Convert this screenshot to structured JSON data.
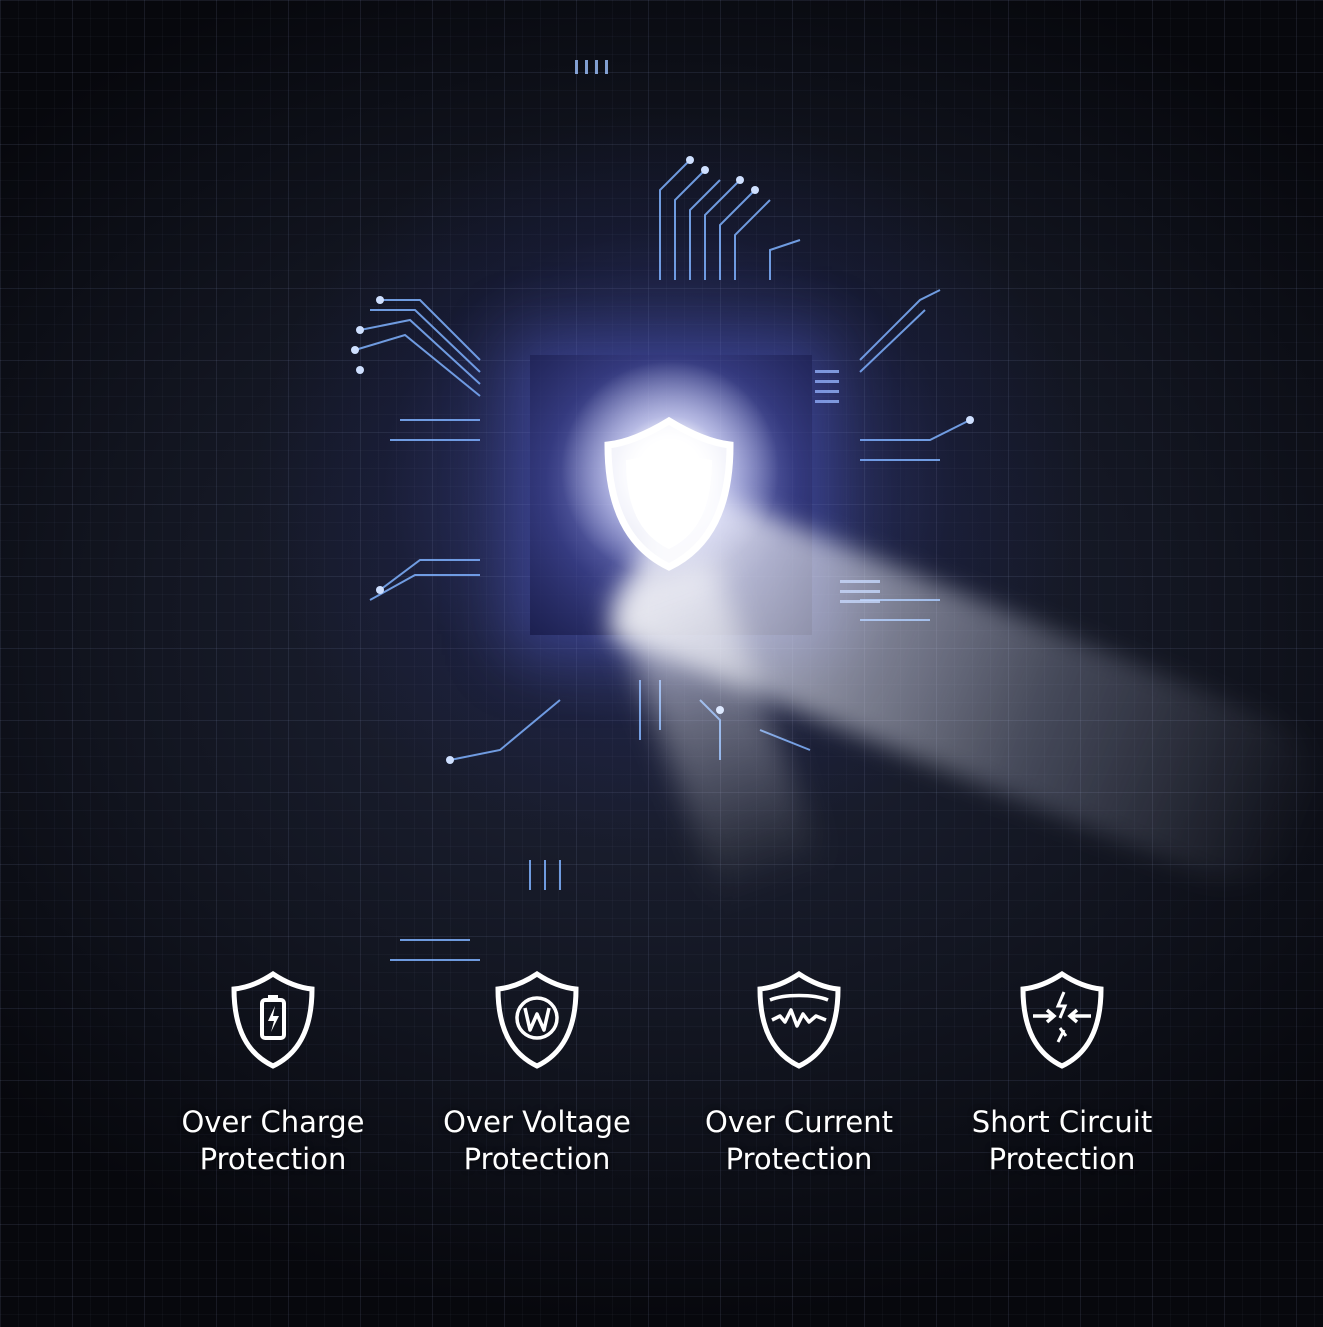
{
  "features": [
    {
      "icon": "battery-shield-icon",
      "line1": "Over Charge",
      "line2": "Protection"
    },
    {
      "icon": "w-shield-icon",
      "line1": "Over Voltage",
      "line2": "Protection"
    },
    {
      "icon": "wave-shield-icon",
      "line1": "Over Current",
      "line2": "Protection"
    },
    {
      "icon": "spark-shield-icon",
      "line1": "Short Circuit",
      "line2": "Protection"
    }
  ],
  "colors": {
    "background": "#0b0d14",
    "chip_glow": "#5a64e6",
    "text": "#ffffff"
  }
}
